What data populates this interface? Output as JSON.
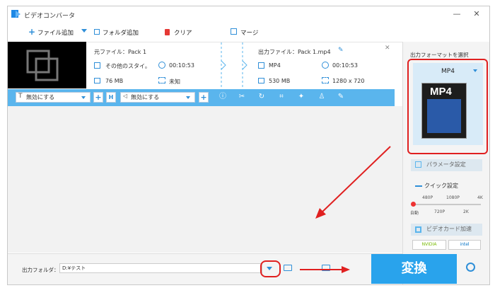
{
  "window": {
    "title": "ビデオコンバータ",
    "minimize": "—",
    "close": "✕"
  },
  "toolbar": {
    "add_file": "ファイル追加",
    "add_folder": "フォルダ追加",
    "clear": "クリア",
    "merge": "マージ"
  },
  "file": {
    "source_name": "元ファイル：Pack 1",
    "source_format": "その他のスタイ。",
    "source_duration": "00:10:53",
    "source_size": "76 MB",
    "source_resolution": "未知",
    "output_name": "出力ファイル：Pack 1.mp4",
    "output_format": "MP4",
    "output_duration": "00:10:53",
    "output_size": "530 MB",
    "output_resolution": "1280 x 720"
  },
  "edit": {
    "subtitle": "無効にする",
    "audio": "無効にする"
  },
  "sidebar": {
    "format_heading": "出力フォーマットを選択",
    "format_selected": "MP4",
    "format_image_text": "MP4",
    "params_button": "パラメータ設定",
    "quick_setting": "クイック設定",
    "quality_top": [
      "480P",
      "1080P",
      "4K"
    ],
    "quality_bottom": [
      "自動",
      "720P",
      "2K"
    ],
    "quality_level": 0,
    "gpu_button": "ビデオカード加速",
    "nvidia": "NVIDIA",
    "intel": "intel"
  },
  "bottom": {
    "folder_label": "出力フォルダ：",
    "folder_path": "D:¥テスト",
    "convert": "変換"
  },
  "colors": {
    "accent": "#5ab5ed",
    "convert": "#29a3ec",
    "annotation": "#e02020"
  }
}
